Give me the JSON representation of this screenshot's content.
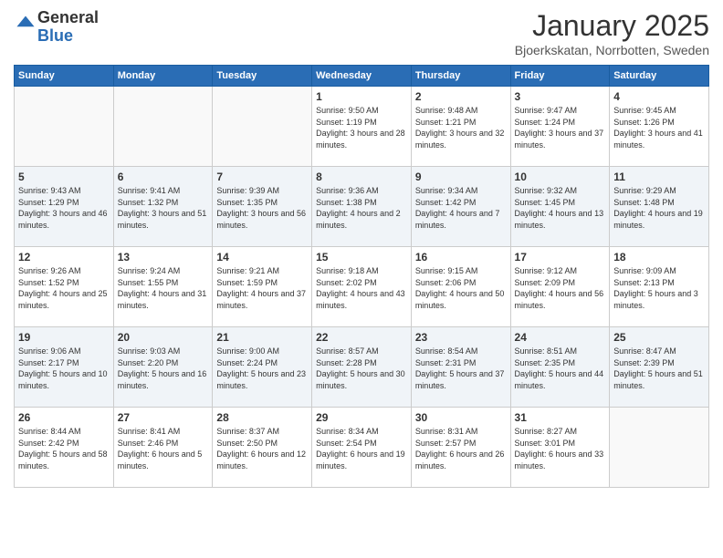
{
  "logo": {
    "general": "General",
    "blue": "Blue"
  },
  "header": {
    "month": "January 2025",
    "location": "Bjoerkskatan, Norrbotten, Sweden"
  },
  "days_of_week": [
    "Sunday",
    "Monday",
    "Tuesday",
    "Wednesday",
    "Thursday",
    "Friday",
    "Saturday"
  ],
  "weeks": [
    [
      {
        "day": "",
        "info": ""
      },
      {
        "day": "",
        "info": ""
      },
      {
        "day": "",
        "info": ""
      },
      {
        "day": "1",
        "info": "Sunrise: 9:50 AM\nSunset: 1:19 PM\nDaylight: 3 hours and 28 minutes."
      },
      {
        "day": "2",
        "info": "Sunrise: 9:48 AM\nSunset: 1:21 PM\nDaylight: 3 hours and 32 minutes."
      },
      {
        "day": "3",
        "info": "Sunrise: 9:47 AM\nSunset: 1:24 PM\nDaylight: 3 hours and 37 minutes."
      },
      {
        "day": "4",
        "info": "Sunrise: 9:45 AM\nSunset: 1:26 PM\nDaylight: 3 hours and 41 minutes."
      }
    ],
    [
      {
        "day": "5",
        "info": "Sunrise: 9:43 AM\nSunset: 1:29 PM\nDaylight: 3 hours and 46 minutes."
      },
      {
        "day": "6",
        "info": "Sunrise: 9:41 AM\nSunset: 1:32 PM\nDaylight: 3 hours and 51 minutes."
      },
      {
        "day": "7",
        "info": "Sunrise: 9:39 AM\nSunset: 1:35 PM\nDaylight: 3 hours and 56 minutes."
      },
      {
        "day": "8",
        "info": "Sunrise: 9:36 AM\nSunset: 1:38 PM\nDaylight: 4 hours and 2 minutes."
      },
      {
        "day": "9",
        "info": "Sunrise: 9:34 AM\nSunset: 1:42 PM\nDaylight: 4 hours and 7 minutes."
      },
      {
        "day": "10",
        "info": "Sunrise: 9:32 AM\nSunset: 1:45 PM\nDaylight: 4 hours and 13 minutes."
      },
      {
        "day": "11",
        "info": "Sunrise: 9:29 AM\nSunset: 1:48 PM\nDaylight: 4 hours and 19 minutes."
      }
    ],
    [
      {
        "day": "12",
        "info": "Sunrise: 9:26 AM\nSunset: 1:52 PM\nDaylight: 4 hours and 25 minutes."
      },
      {
        "day": "13",
        "info": "Sunrise: 9:24 AM\nSunset: 1:55 PM\nDaylight: 4 hours and 31 minutes."
      },
      {
        "day": "14",
        "info": "Sunrise: 9:21 AM\nSunset: 1:59 PM\nDaylight: 4 hours and 37 minutes."
      },
      {
        "day": "15",
        "info": "Sunrise: 9:18 AM\nSunset: 2:02 PM\nDaylight: 4 hours and 43 minutes."
      },
      {
        "day": "16",
        "info": "Sunrise: 9:15 AM\nSunset: 2:06 PM\nDaylight: 4 hours and 50 minutes."
      },
      {
        "day": "17",
        "info": "Sunrise: 9:12 AM\nSunset: 2:09 PM\nDaylight: 4 hours and 56 minutes."
      },
      {
        "day": "18",
        "info": "Sunrise: 9:09 AM\nSunset: 2:13 PM\nDaylight: 5 hours and 3 minutes."
      }
    ],
    [
      {
        "day": "19",
        "info": "Sunrise: 9:06 AM\nSunset: 2:17 PM\nDaylight: 5 hours and 10 minutes."
      },
      {
        "day": "20",
        "info": "Sunrise: 9:03 AM\nSunset: 2:20 PM\nDaylight: 5 hours and 16 minutes."
      },
      {
        "day": "21",
        "info": "Sunrise: 9:00 AM\nSunset: 2:24 PM\nDaylight: 5 hours and 23 minutes."
      },
      {
        "day": "22",
        "info": "Sunrise: 8:57 AM\nSunset: 2:28 PM\nDaylight: 5 hours and 30 minutes."
      },
      {
        "day": "23",
        "info": "Sunrise: 8:54 AM\nSunset: 2:31 PM\nDaylight: 5 hours and 37 minutes."
      },
      {
        "day": "24",
        "info": "Sunrise: 8:51 AM\nSunset: 2:35 PM\nDaylight: 5 hours and 44 minutes."
      },
      {
        "day": "25",
        "info": "Sunrise: 8:47 AM\nSunset: 2:39 PM\nDaylight: 5 hours and 51 minutes."
      }
    ],
    [
      {
        "day": "26",
        "info": "Sunrise: 8:44 AM\nSunset: 2:42 PM\nDaylight: 5 hours and 58 minutes."
      },
      {
        "day": "27",
        "info": "Sunrise: 8:41 AM\nSunset: 2:46 PM\nDaylight: 6 hours and 5 minutes."
      },
      {
        "day": "28",
        "info": "Sunrise: 8:37 AM\nSunset: 2:50 PM\nDaylight: 6 hours and 12 minutes."
      },
      {
        "day": "29",
        "info": "Sunrise: 8:34 AM\nSunset: 2:54 PM\nDaylight: 6 hours and 19 minutes."
      },
      {
        "day": "30",
        "info": "Sunrise: 8:31 AM\nSunset: 2:57 PM\nDaylight: 6 hours and 26 minutes."
      },
      {
        "day": "31",
        "info": "Sunrise: 8:27 AM\nSunset: 3:01 PM\nDaylight: 6 hours and 33 minutes."
      },
      {
        "day": "",
        "info": ""
      }
    ]
  ]
}
